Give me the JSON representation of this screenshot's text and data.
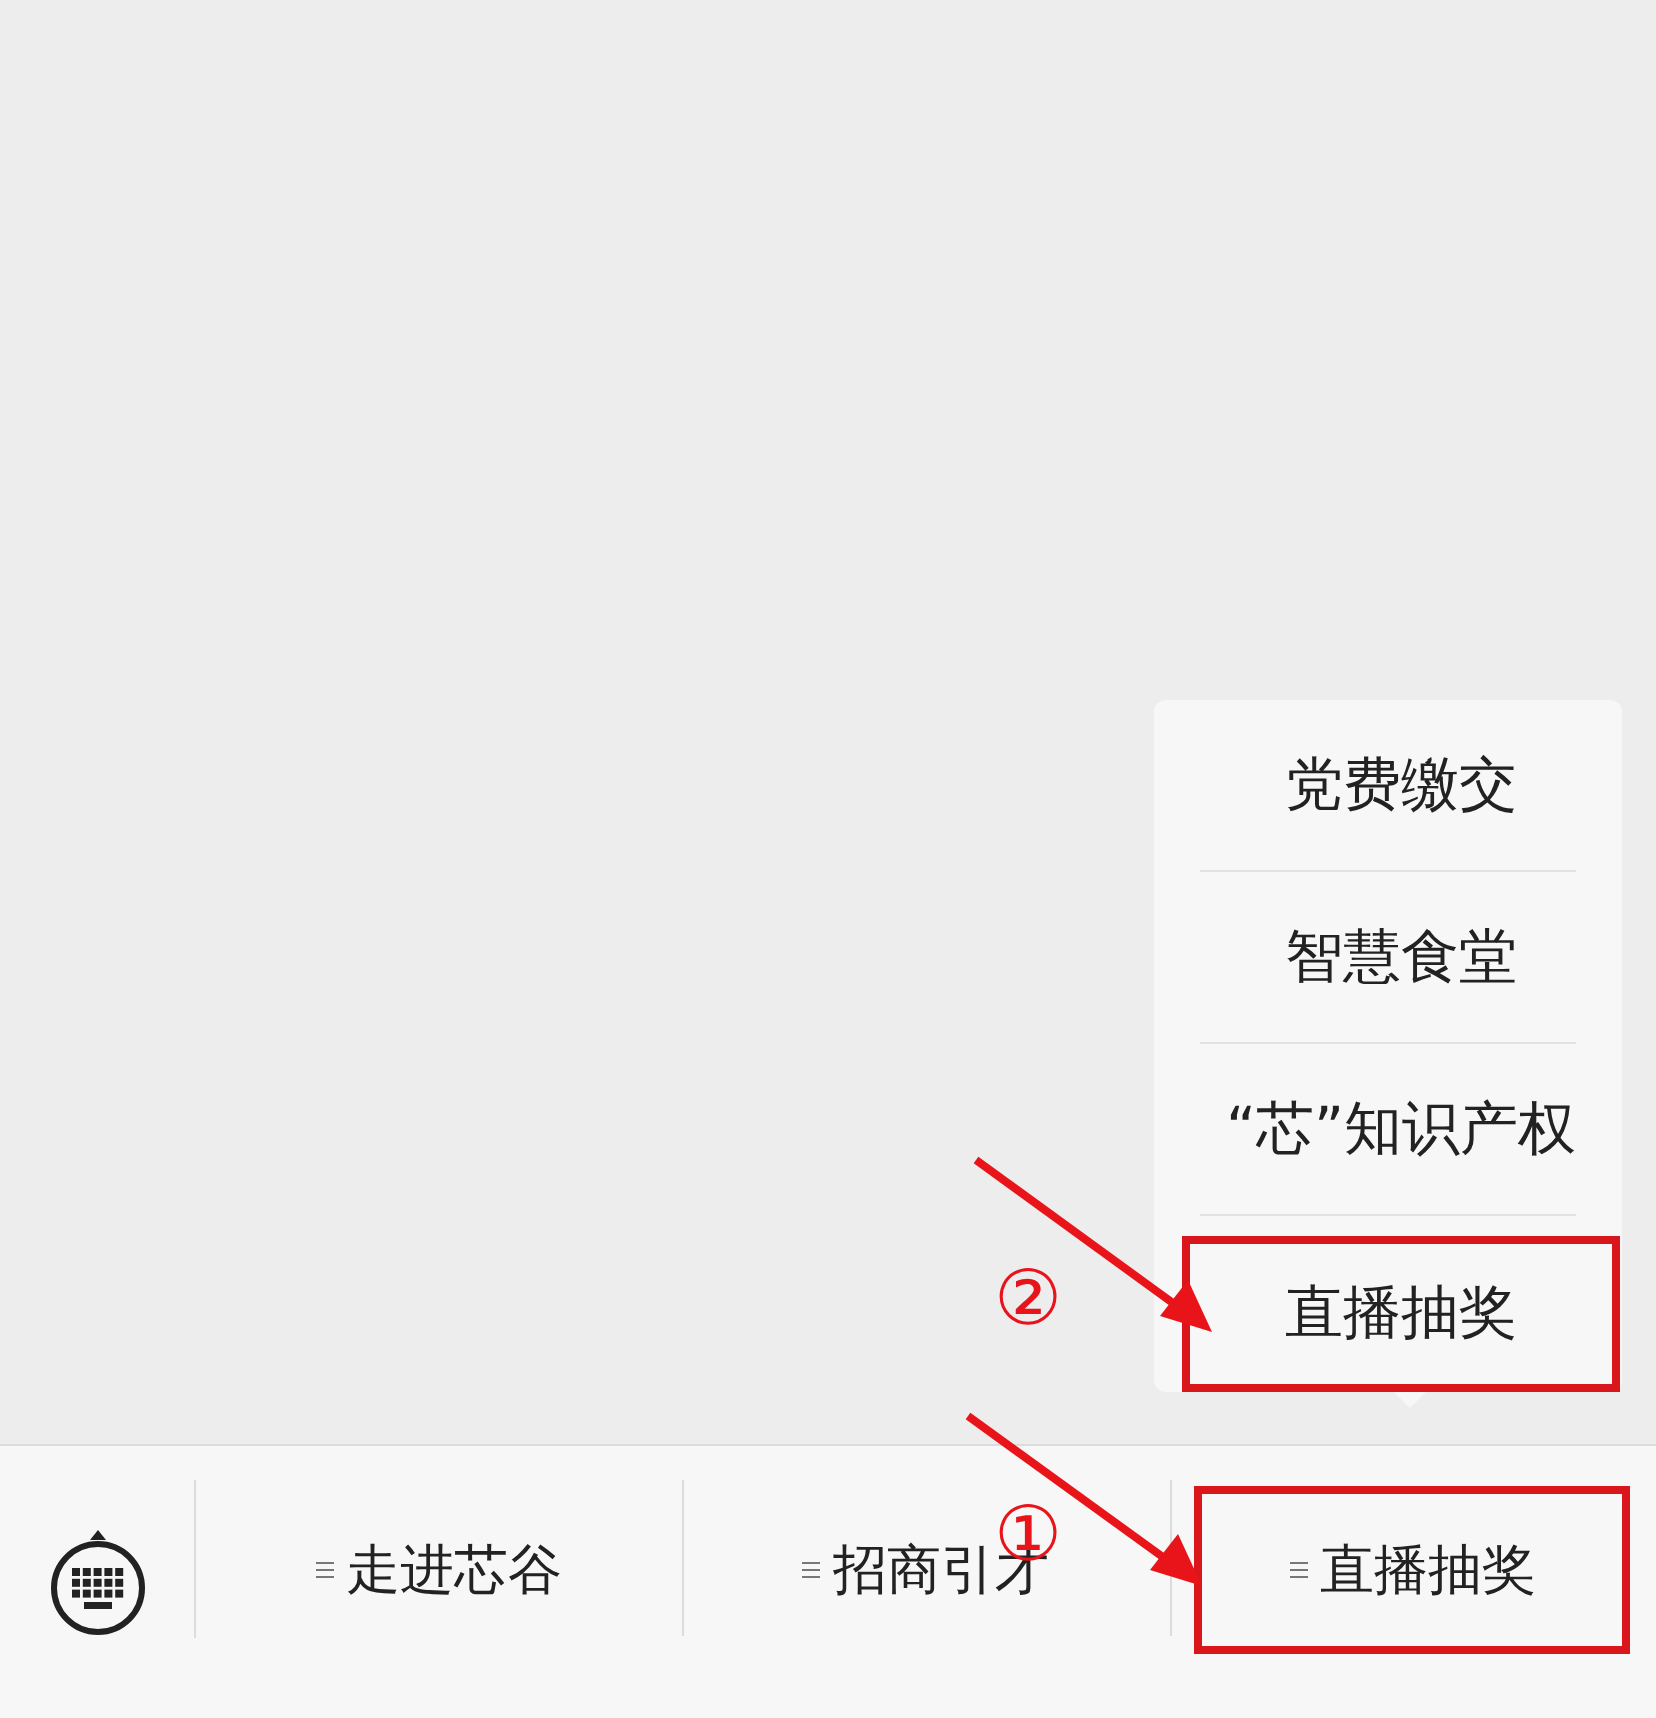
{
  "popup_menu": {
    "items": [
      {
        "label": "党费缴交",
        "highlighted": false
      },
      {
        "label": "智慧食堂",
        "highlighted": false
      },
      {
        "label": "“芯”知识产权",
        "highlighted": false
      },
      {
        "label": "直播抽奖",
        "highlighted": true
      }
    ]
  },
  "bottom_menu": {
    "items": [
      {
        "label": "走进芯谷",
        "highlighted": false
      },
      {
        "label": "招商引才",
        "highlighted": false
      },
      {
        "label": "直播抽奖",
        "highlighted": true
      }
    ]
  },
  "callouts": [
    {
      "label": "②"
    },
    {
      "label": "①"
    }
  ]
}
